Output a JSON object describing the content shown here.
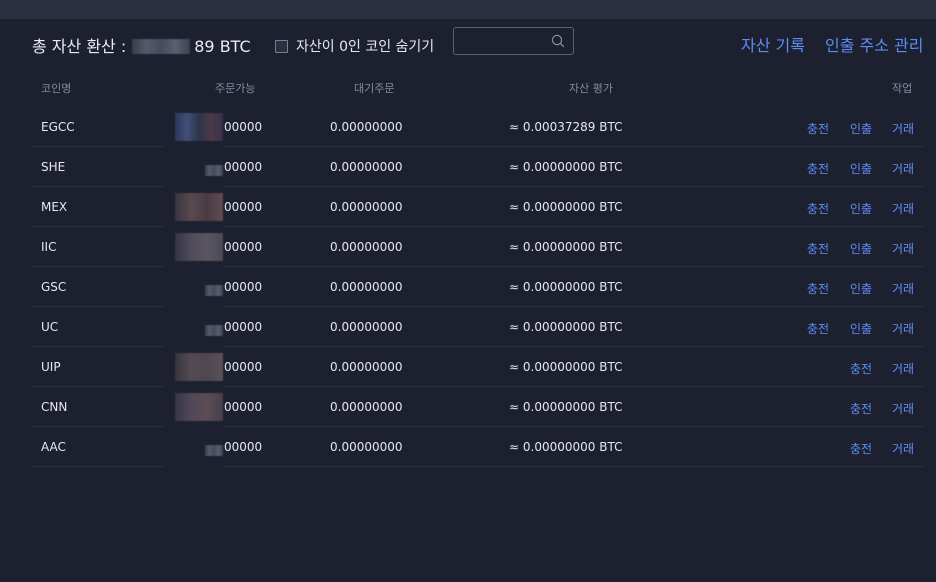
{
  "header": {
    "total_label": "총 자산 환산 :",
    "total_value_visible": "89 BTC",
    "hide_zero_label": "자산이 0인 코인 숨기기",
    "hide_zero_checked": false,
    "search_placeholder": "",
    "history_link": "자산 기록",
    "withdraw_address_link": "인출 주소 관리"
  },
  "table": {
    "columns": [
      "코인명",
      "주문가능",
      "대기주문",
      "자산 평가",
      "작업"
    ],
    "rows": [
      {
        "coin": "EGCC",
        "available": "00000",
        "pending": "0.00000000",
        "value": "≈ 0.00037289 BTC",
        "deposit": "충전",
        "withdraw": "인출",
        "trade": "거래"
      },
      {
        "coin": "SHE",
        "available": "00000",
        "pending": "0.00000000",
        "value": "≈ 0.00000000 BTC",
        "deposit": "충전",
        "withdraw": "인출",
        "trade": "거래"
      },
      {
        "coin": "MEX",
        "available": "00000",
        "pending": "0.00000000",
        "value": "≈ 0.00000000 BTC",
        "deposit": "충전",
        "withdraw": "인출",
        "trade": "거래"
      },
      {
        "coin": "IIC",
        "available": "00000",
        "pending": "0.00000000",
        "value": "≈ 0.00000000 BTC",
        "deposit": "충전",
        "withdraw": "인출",
        "trade": "거래"
      },
      {
        "coin": "GSC",
        "available": "00000",
        "pending": "0.00000000",
        "value": "≈ 0.00000000 BTC",
        "deposit": "충전",
        "withdraw": "인출",
        "trade": "거래"
      },
      {
        "coin": "UC",
        "available": "00000",
        "pending": "0.00000000",
        "value": "≈ 0.00000000 BTC",
        "deposit": "충전",
        "withdraw": "인출",
        "trade": "거래"
      },
      {
        "coin": "UIP",
        "available": "00000",
        "pending": "0.00000000",
        "value": "≈ 0.00000000 BTC",
        "deposit": "충전",
        "trade": "거래"
      },
      {
        "coin": "CNN",
        "available": "00000",
        "pending": "0.00000000",
        "value": "≈ 0.00000000 BTC",
        "deposit": "충전",
        "trade": "거래"
      },
      {
        "coin": "AAC",
        "available": "00000",
        "pending": "0.00000000",
        "value": "≈ 0.00000000 BTC",
        "deposit": "충전",
        "trade": "거래"
      }
    ]
  },
  "colors": {
    "background": "#1d202e",
    "accent_link": "#5d8cf4",
    "header_text": "#858a9e"
  }
}
